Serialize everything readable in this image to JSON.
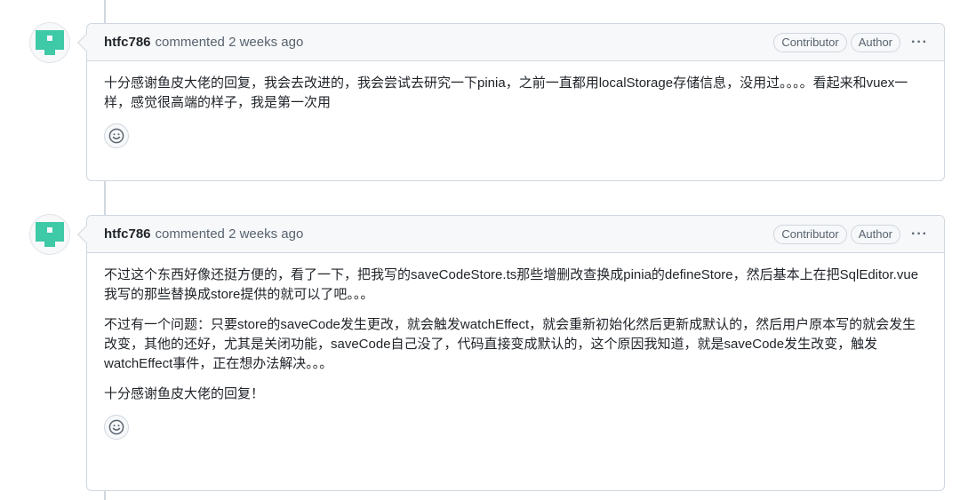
{
  "comments": [
    {
      "author": "htfc786",
      "meta": "commented 2 weeks ago",
      "badges": [
        "Contributor",
        "Author"
      ],
      "more_label": "···",
      "paragraphs": [
        "十分感谢鱼皮大佬的回复，我会去改进的，我会尝试去研究一下pinia，之前一直都用localStorage存储信息，没用过。。。。看起来和vuex一样，感觉很高端的样子，我是第一次用"
      ],
      "reaction_icon": "smiley-icon"
    },
    {
      "author": "htfc786",
      "meta": "commented 2 weeks ago",
      "badges": [
        "Contributor",
        "Author"
      ],
      "more_label": "···",
      "paragraphs": [
        "不过这个东西好像还挺方便的，看了一下，把我写的saveCodeStore.ts那些增删改查换成pinia的defineStore，然后基本上在把SqlEditor.vue我写的那些替换成store提供的就可以了吧。。。",
        "不过有一个问题：只要store的saveCode发生更改，就会触发watchEffect，就会重新初始化然后更新成默认的，然后用户原本写的就会发生改变，其他的还好，尤其是关闭功能，saveCode自己没了，代码直接变成默认的，这个原因我知道，就是saveCode发生改变，触发watchEffect事件，正在想办法解决。。。",
        "十分感谢鱼皮大佬的回复！"
      ],
      "reaction_icon": "smiley-icon"
    }
  ],
  "colors": {
    "avatar": "#3ec9a7",
    "border": "#d0d7de",
    "header_bg": "#f6f8fa",
    "muted_text": "#59636e"
  }
}
